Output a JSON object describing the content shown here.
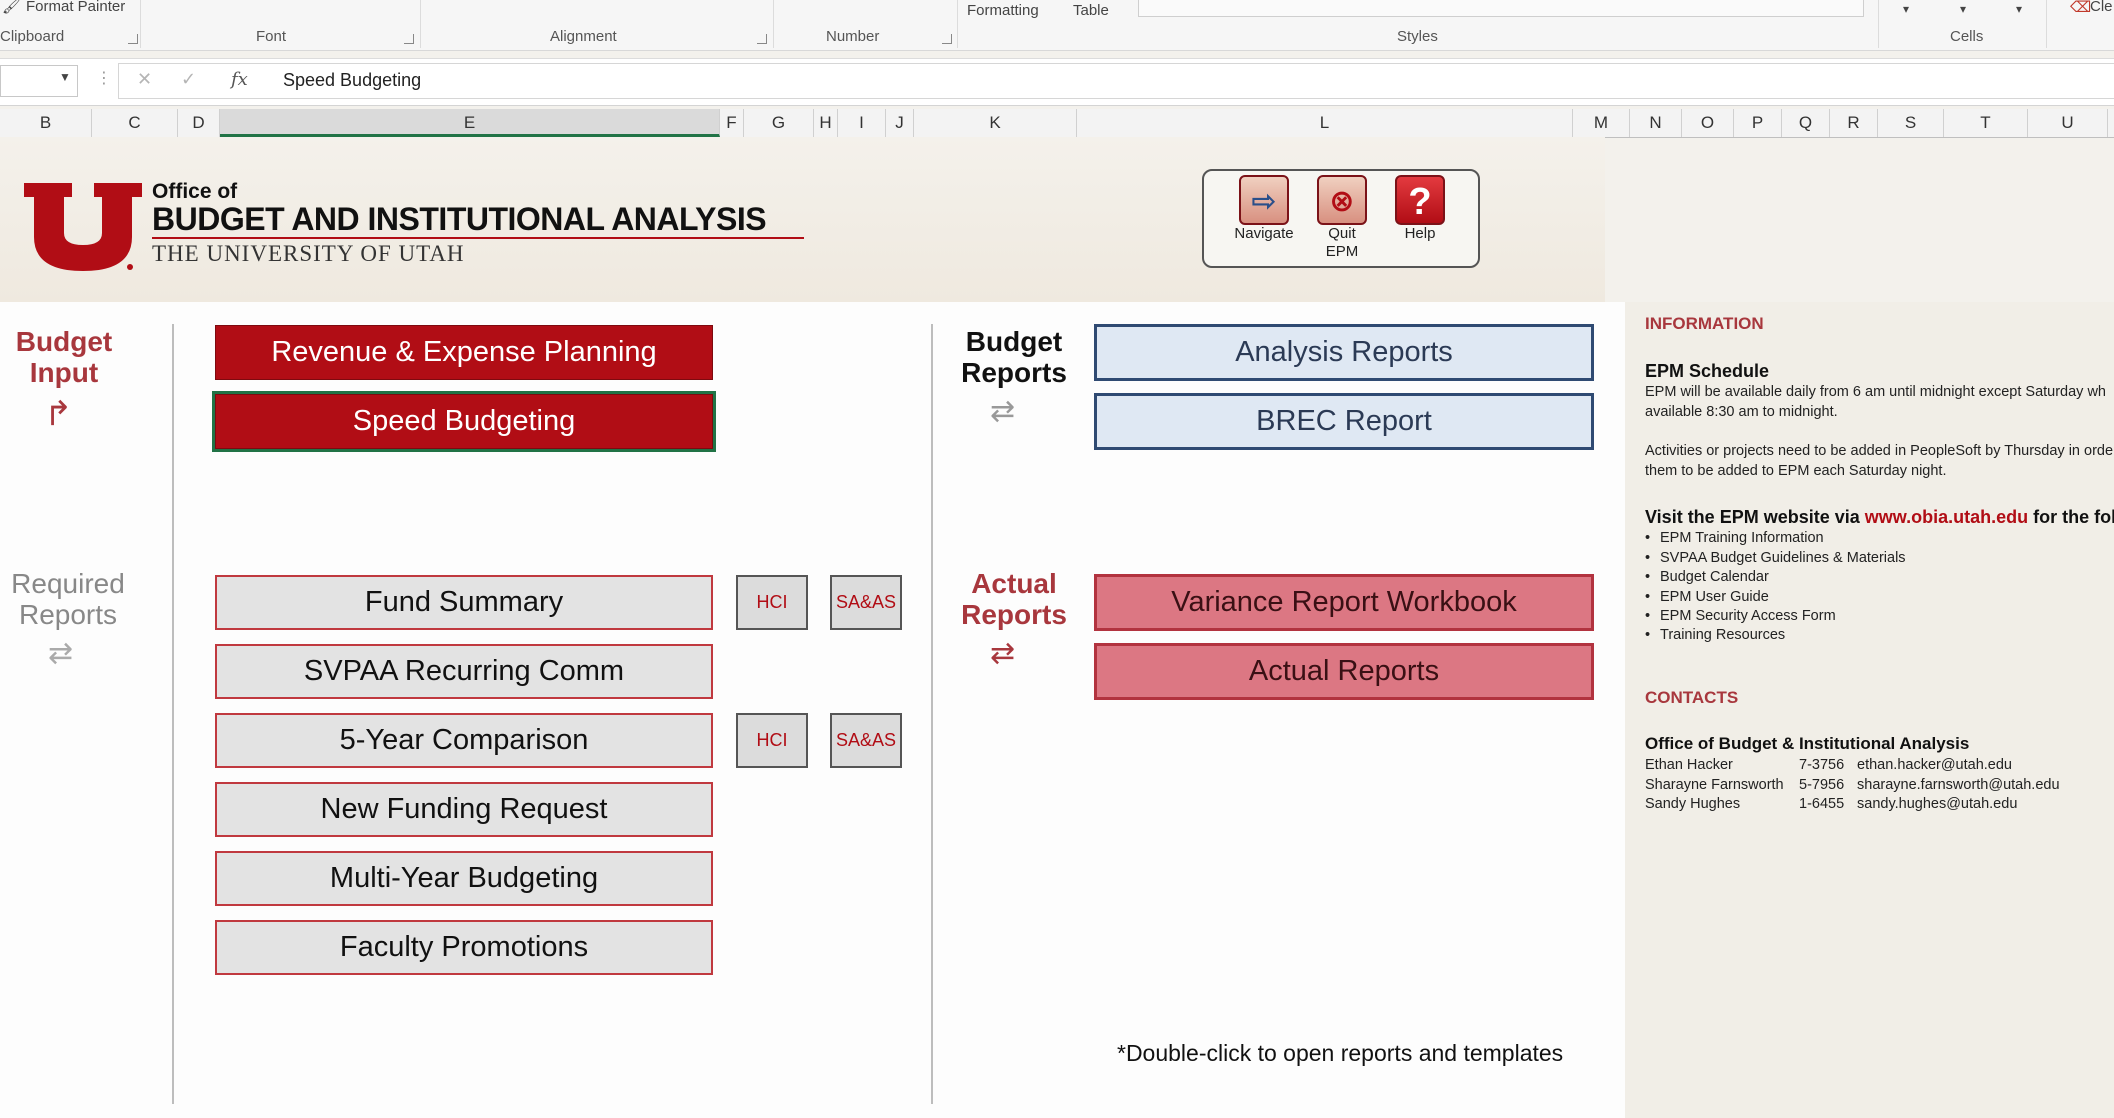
{
  "ribbon": {
    "format_painter": "Format Painter",
    "formatting": "Formatting",
    "table": "Table",
    "clear": "Cle",
    "groups": {
      "clipboard": "Clipboard",
      "font": "Font",
      "alignment": "Alignment",
      "number": "Number",
      "styles": "Styles",
      "cells": "Cells"
    }
  },
  "formula_bar": {
    "name_box": "",
    "cancel": "✕",
    "enter": "✓",
    "fx": "fx",
    "value": "Speed Budgeting"
  },
  "columns": [
    "B",
    "C",
    "D",
    "E",
    "F",
    "G",
    "H",
    "I",
    "J",
    "K",
    "L",
    "M",
    "N",
    "O",
    "P",
    "Q",
    "R",
    "S",
    "T",
    "U"
  ],
  "selected_column": "E",
  "header": {
    "office_of": "Office of",
    "title": "BUDGET AND INSTITUTIONAL ANALYSIS",
    "university": "THE UNIVERSITY OF UTAH",
    "logo_letter": "U"
  },
  "nav": {
    "navigate": "Navigate",
    "quit": "Quit\nEPM",
    "help": "Help",
    "help_glyph": "?"
  },
  "sections": {
    "budget_input": "Budget\nInput",
    "required_reports": "Required\nReports",
    "budget_reports": "Budget\nReports",
    "actual_reports": "Actual\nReports"
  },
  "buttons": {
    "revenue_expense": "Revenue & Expense Planning",
    "speed_budgeting": "Speed Budgeting",
    "fund_summary": "Fund Summary",
    "svpaa_recurring": "SVPAA Recurring Comm",
    "five_year": "5-Year Comparison",
    "new_funding": "New Funding Request",
    "multi_year": "Multi-Year Budgeting",
    "faculty_promotions": "Faculty Promotions",
    "hci_1": "HCI",
    "saas_1": "SA&AS",
    "hci_2": "HCI",
    "saas_2": "SA&AS",
    "analysis_reports": "Analysis Reports",
    "brec_report": "BREC Report",
    "variance_workbook": "Variance Report Workbook",
    "actual_reports": "Actual Reports"
  },
  "note": "*Double-click to open reports and templates",
  "sidebar": {
    "info_heading": "INFORMATION",
    "schedule_title": "EPM Schedule",
    "schedule_lines": [
      "EPM will be available daily from 6 am until midnight except Saturday wh",
      "available 8:30 am to midnight.",
      "Activities or projects need to be added in PeopleSoft by Thursday in orde",
      "them to be added to EPM each Saturday night."
    ],
    "visit_prefix": "Visit the EPM website via ",
    "visit_link": "www.obia.utah.edu",
    "visit_suffix": " for the follo",
    "bullets": [
      "EPM Training Information",
      "SVPAA Budget Guidelines & Materials",
      "Budget Calendar",
      "EPM User Guide",
      "EPM Security Access Form",
      "Training Resources"
    ],
    "contacts_heading": "CONTACTS",
    "office_name": "Office of Budget & Institutional Analysis",
    "contacts": [
      {
        "name": "Ethan Hacker",
        "phone": "7-3756",
        "email": "ethan.hacker@utah.edu"
      },
      {
        "name": "Sharayne Farnsworth",
        "phone": "5-7956",
        "email": "sharayne.farnsworth@utah.edu"
      },
      {
        "name": "Sandy Hughes",
        "phone": "1-6455",
        "email": "sandy.hughes@utah.edu"
      }
    ]
  },
  "colors": {
    "utah_red": "#b10d15",
    "blue_border": "#2f4a72",
    "pink": "#dc7783",
    "excel_green": "#217346"
  }
}
